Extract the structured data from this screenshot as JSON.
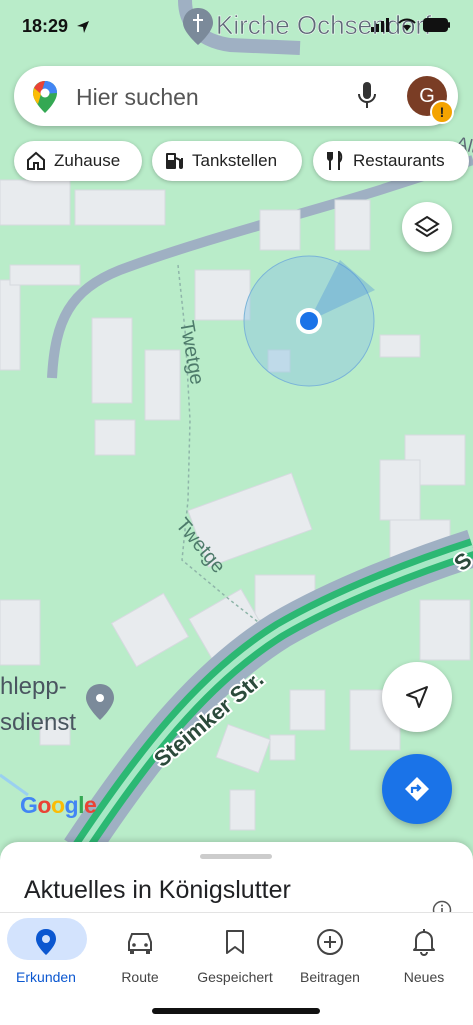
{
  "status_bar": {
    "time": "18:29"
  },
  "map": {
    "labels": {
      "church": "Kirche Ochsendorf",
      "path1": "Twetge",
      "path2": "Twetge",
      "street": "Steimker Str.",
      "poi_line1": "hlepp-",
      "poi_line2": "sdienst",
      "edge_text": "Alte",
      "edge_s": "S"
    },
    "google_logo": [
      "G",
      "o",
      "o",
      "g",
      "l",
      "e"
    ],
    "colors": {
      "map_bg": "#b9ecc9",
      "road_green": "#2cb873",
      "location_blue": "#1a73e8"
    }
  },
  "search": {
    "placeholder": "Hier suchen",
    "avatar_letter": "G",
    "warning_mark": "!"
  },
  "chips": [
    {
      "label": "Zuhause",
      "icon": "home-icon"
    },
    {
      "label": "Tankstellen",
      "icon": "gas-station-icon"
    },
    {
      "label": "Restaurants",
      "icon": "restaurant-icon"
    }
  ],
  "sheet": {
    "title": "Aktuelles in Königslutter"
  },
  "bottom_nav": [
    {
      "label": "Erkunden",
      "icon": "location-pin-icon",
      "active": true
    },
    {
      "label": "Route",
      "icon": "car-icon"
    },
    {
      "label": "Gespeichert",
      "icon": "bookmark-icon"
    },
    {
      "label": "Beitragen",
      "icon": "add-circle-icon"
    },
    {
      "label": "Neues",
      "icon": "bell-icon"
    }
  ]
}
